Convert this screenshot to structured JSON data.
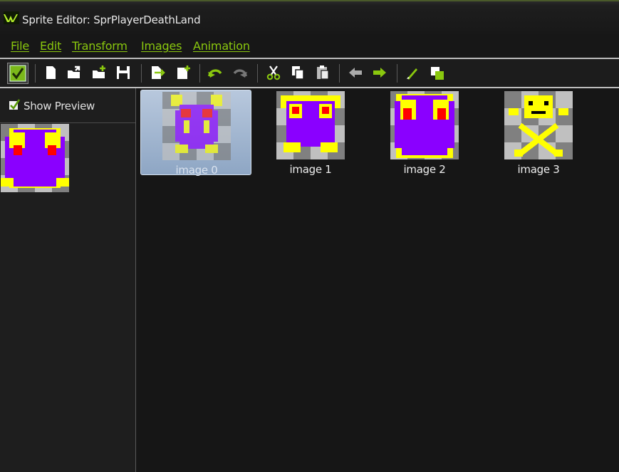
{
  "window": {
    "title": "Sprite Editor: SprPlayerDeathLand"
  },
  "menu": [
    {
      "label": "File"
    },
    {
      "label": "Edit"
    },
    {
      "label": "Transform"
    },
    {
      "label": "Images"
    },
    {
      "label": "Animation"
    }
  ],
  "toolbar": {
    "buttons": [
      "ok-icon",
      "new-icon",
      "open-icon",
      "add-icon",
      "save-icon",
      "insert-empty-icon",
      "add-empty-icon",
      "undo-icon",
      "redo-icon",
      "cut-icon",
      "copy-icon",
      "paste-icon",
      "shift-left-icon",
      "shift-right-icon",
      "edit-icon",
      "background-icon"
    ]
  },
  "left_panel": {
    "show_preview_label": "Show Preview",
    "show_preview_checked": true
  },
  "frames": [
    {
      "label": "image 0",
      "selected": true
    },
    {
      "label": "image 1",
      "selected": false
    },
    {
      "label": "image 2",
      "selected": false
    },
    {
      "label": "image 3",
      "selected": false
    }
  ],
  "colors": {
    "accent": "#8ac80e",
    "sprite_purple": "#8a00ff",
    "sprite_yellow": "#ffff00",
    "sprite_red": "#ff0000",
    "checker_light": "#c0c0c0",
    "checker_dark": "#808080"
  }
}
